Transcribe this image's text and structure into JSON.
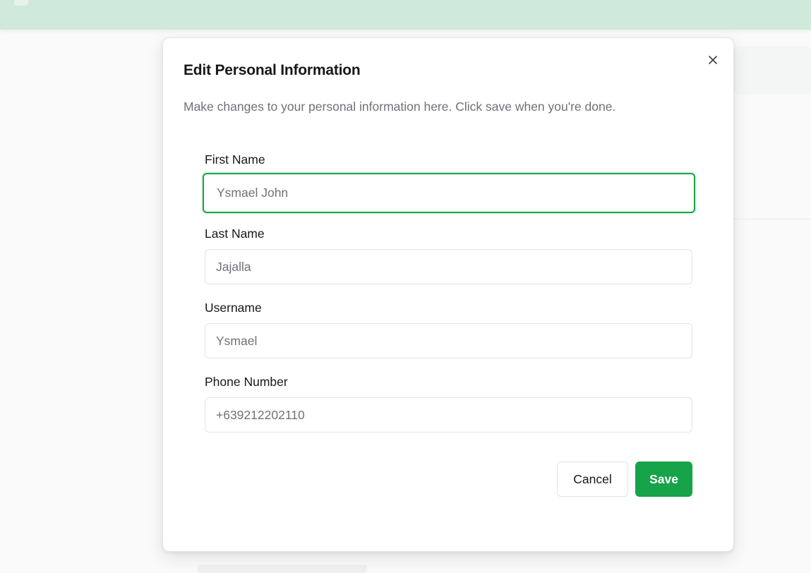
{
  "dialog": {
    "title": "Edit Personal Information",
    "description": "Make changes to your personal information here. Click save when you're done.",
    "close_icon": "close-icon"
  },
  "fields": [
    {
      "label": "First Name",
      "placeholder": "Ysmael John",
      "value": "",
      "focused": true
    },
    {
      "label": "Last Name",
      "placeholder": "Jajalla",
      "value": ""
    },
    {
      "label": "Username",
      "placeholder": "Ysmael",
      "value": ""
    },
    {
      "label": "Phone Number",
      "placeholder": "+639212202110",
      "value": ""
    }
  ],
  "actions": {
    "cancel_label": "Cancel",
    "save_label": "Save"
  },
  "colors": {
    "accent": "#16a34a",
    "header_bg": "#cfeada",
    "muted_text": "#71717a",
    "border": "#e4e4e7"
  }
}
